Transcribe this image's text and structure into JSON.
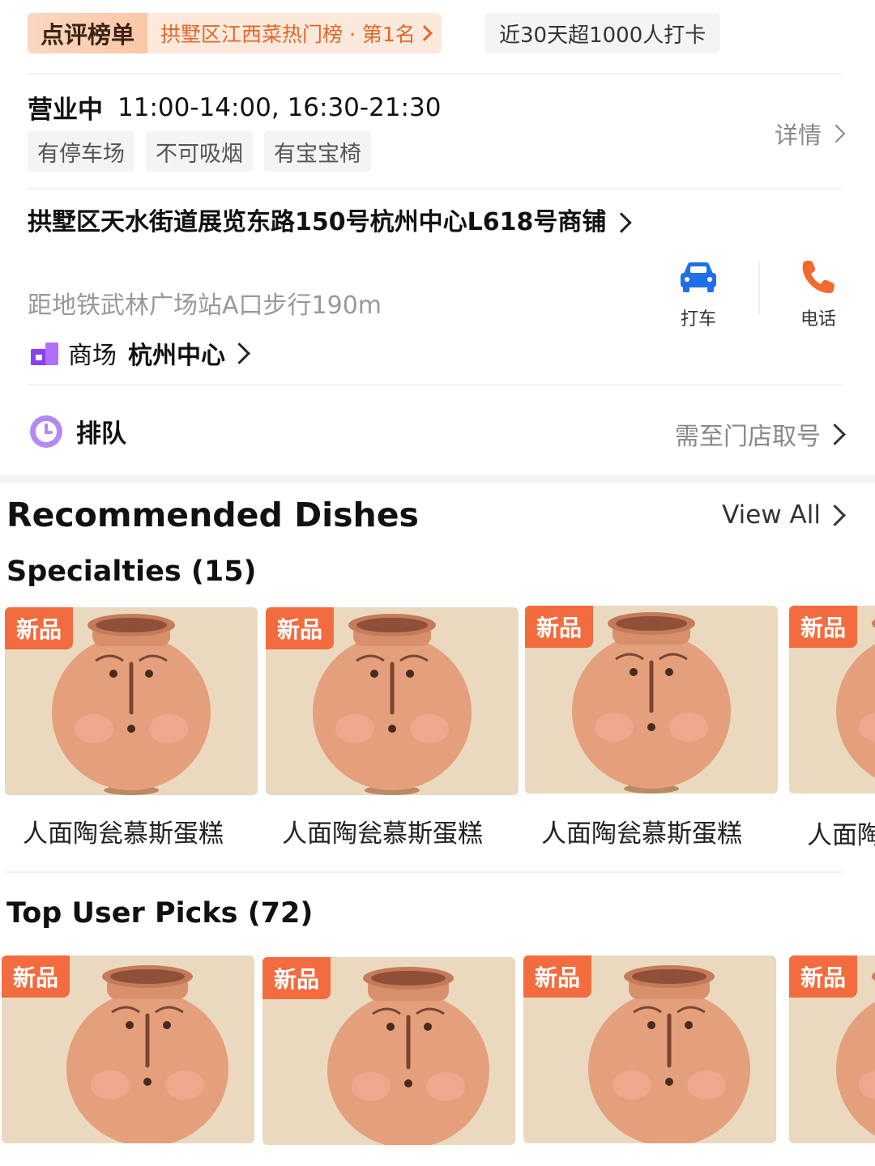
{
  "ranking": {
    "badge": "点评榜单",
    "text": "拱墅区江西菜热门榜 · 第1名",
    "checkin": "近30天超1000人打卡"
  },
  "hours": {
    "status": "营业中",
    "times": "11:00-14:00, 16:30-21:30",
    "details_label": "详情",
    "tags": [
      "有停车场",
      "不可吸烟",
      "有宝宝椅"
    ]
  },
  "address": {
    "text": "拱墅区天水街道展览东路150号杭州中心L618号商铺",
    "metro": "距地铁武林广场站A口步行190m",
    "mall_type": "商场",
    "mall_name": "杭州中心"
  },
  "actions": {
    "taxi": "打车",
    "phone": "电话"
  },
  "queue": {
    "label": "排队",
    "note": "需至门店取号"
  },
  "recommended": {
    "title": "Recommended Dishes",
    "view_all": "View All",
    "specialties": {
      "title": "Specialties (15)",
      "items": [
        {
          "badge": "新品",
          "name": "人面陶瓮慕斯蛋糕"
        },
        {
          "badge": "新品",
          "name": "人面陶瓮慕斯蛋糕"
        },
        {
          "badge": "新品",
          "name": "人面陶瓮慕斯蛋糕"
        },
        {
          "badge": "新品",
          "name": "人面陶瓮慕斯蛋糕"
        }
      ]
    },
    "top_picks": {
      "title": "Top User Picks (72)",
      "items": [
        {
          "badge": "新品"
        },
        {
          "badge": "新品"
        },
        {
          "badge": "新品"
        },
        {
          "badge": "新品"
        }
      ]
    }
  },
  "colors": {
    "accent_orange": "#e2672a",
    "badge_orange": "#f26c40",
    "taxi_blue": "#1f6fe6",
    "phone_orange": "#f26a2e",
    "queue_purple": "#b48af0"
  }
}
